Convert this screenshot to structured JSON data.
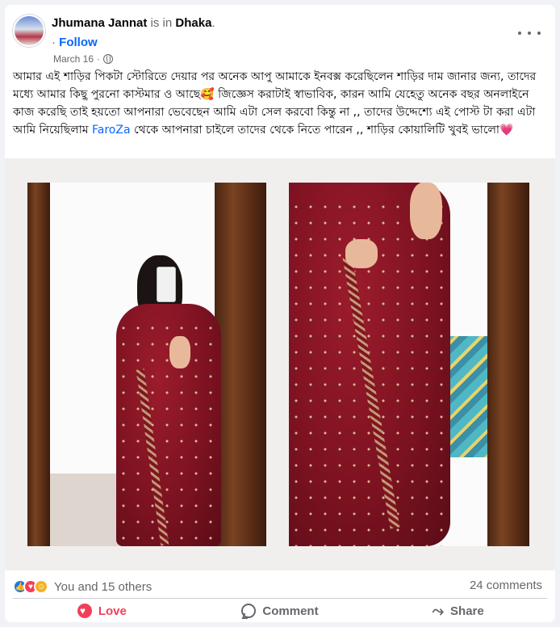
{
  "post": {
    "author": "Jhumana Jannat",
    "is_in_text": "is in",
    "location": "Dhaka",
    "location_suffix": ".",
    "follow_prefix": "·",
    "follow_label": "Follow",
    "date": "March 16",
    "date_sep": "·",
    "privacy_icon": "globe-icon",
    "more_icon": "more-options-icon",
    "text_part1": "আমার এই শাড়ির পিকটা স্টোরিতে  দেয়ার পর অনেক আপু আমাকে ইনবক্স করেছিলেন শাড়ির দাম জানার জন্য, তাদের মধ্যে আমার কিছু পুরনো কাস্টমার ও আছে🥰  জিজ্ঞেস করাটাই স্বাভাবিক, কারন আমি যেহেতু অনেক বছর অনলাইনে কাজ করেছি  তাই হয়তো আপনারা ভেবেছেন আমি এটা সেল করবো কিন্তু না ,, তাদের উদ্দেশ্যে এই পোস্ট  টা করা এটা আমি নিয়েছিলাম ",
    "text_link": "FaroZa",
    "text_part2": " থেকে আপনারা চাইলে তাদের থেকে নিতে পারেন ,, শাড়ির কোয়ালিটি খুবই ভালো💗"
  },
  "reactions": {
    "icons": [
      "like-icon",
      "love-icon",
      "care-icon"
    ],
    "summary": "You and 15 others",
    "comments": "24 comments"
  },
  "actions": {
    "love_label": "Love",
    "comment_label": "Comment",
    "share_label": "Share"
  },
  "colors": {
    "accent": "#0866ff",
    "love": "#f33e58",
    "muted": "#65676b"
  }
}
